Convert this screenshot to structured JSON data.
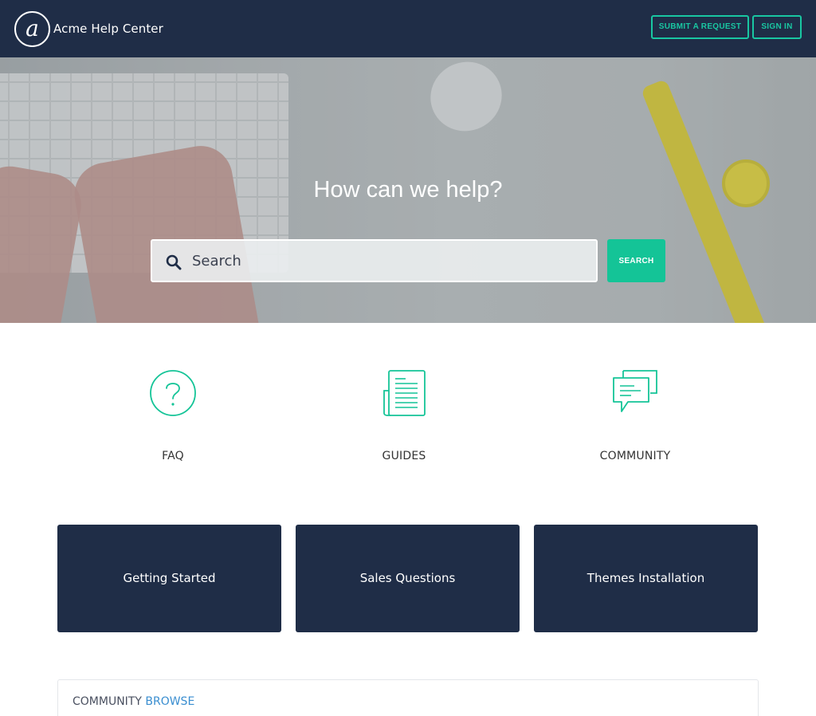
{
  "header": {
    "logo_icon": "at-sign-logo-icon",
    "brand": "Acme Help Center",
    "submit_request": "SUBMIT A REQUEST",
    "sign_in": "SIGN IN",
    "accent_color": "#19c7a2",
    "background_color": "#1f2d47"
  },
  "hero": {
    "title": "How can we help?",
    "search_placeholder": "Search",
    "search_button": "SEARCH",
    "search_icon": "search-icon"
  },
  "features": [
    {
      "label": "FAQ",
      "icon": "question-circle-icon"
    },
    {
      "label": "GUIDES",
      "icon": "document-icon"
    },
    {
      "label": "COMMUNITY",
      "icon": "chat-bubbles-icon"
    }
  ],
  "categories": [
    {
      "label": "Getting Started"
    },
    {
      "label": "Sales Questions"
    },
    {
      "label": "Themes Installation"
    }
  ],
  "community": {
    "title": "COMMUNITY",
    "browse": "BROWSE"
  }
}
